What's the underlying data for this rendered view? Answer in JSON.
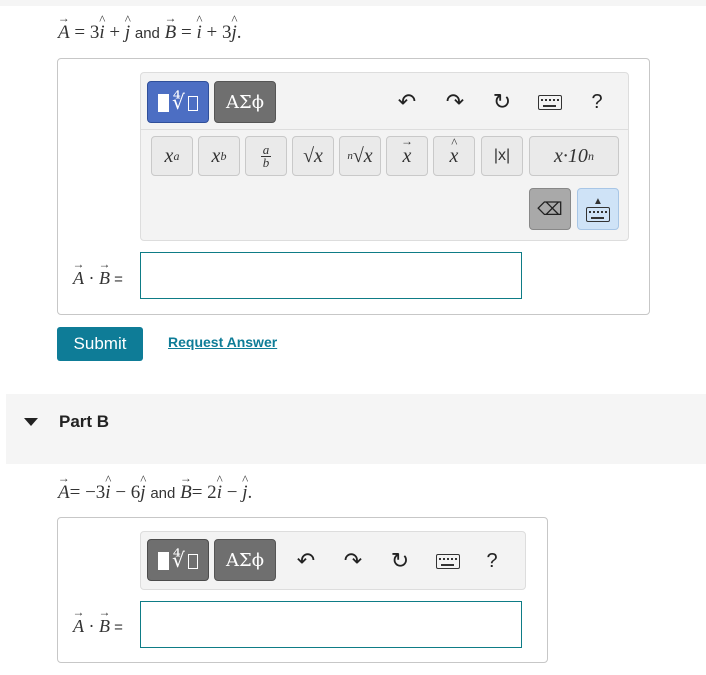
{
  "part_a": {
    "prompt": {
      "A_rhs": "= 3",
      "A_plus": " + ",
      "and": "and",
      "B_rhs": "=",
      "B_plus": " + 3",
      "i": "i",
      "j": "j",
      "A": "A",
      "B": "B",
      "end": "."
    },
    "toolbar": {
      "templates_label": "√",
      "greek_label": "ΑΣϕ",
      "help_label": "?",
      "symbols": [
        "xᵃ",
        "x_b",
        "a/b",
        "√x",
        "ⁿ√x",
        "x⃗",
        "x̂",
        "|x|",
        "x·10ⁿ"
      ]
    },
    "answer_label": "A · B =",
    "answer_value": ""
  },
  "submit_label": "Submit",
  "request_answer_label": "Request Answer",
  "part_b": {
    "title": "Part B",
    "prompt": {
      "A_rhs": "= −3",
      "A_minus": " − 6",
      "and": "and",
      "B_rhs": "= 2",
      "B_minus": " − ",
      "end": "."
    },
    "toolbar": {
      "templates_label": "√",
      "greek_label": "ΑΣϕ",
      "help_label": "?"
    },
    "answer_label": "A · B =",
    "answer_value": ""
  },
  "colors": {
    "accent": "#0e7c97",
    "templates_active": "#4c6ec3",
    "toolbar_bg": "#f3f3f3",
    "input_border": "#0e7c86"
  }
}
